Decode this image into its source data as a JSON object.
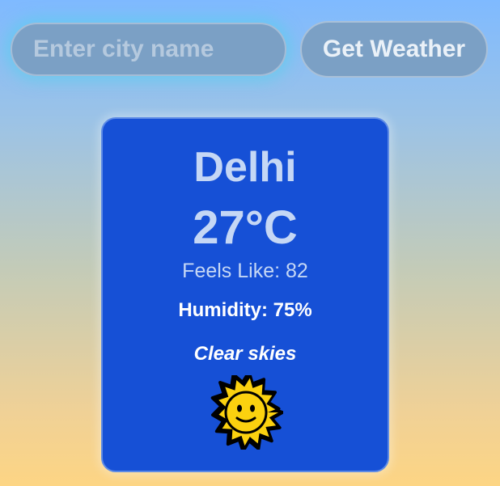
{
  "search": {
    "placeholder": "Enter city name",
    "button_label": "Get Weather"
  },
  "weather": {
    "city": "Delhi",
    "temperature": "27°C",
    "feels_like": "Feels Like: 82",
    "humidity": "Humidity: 75%",
    "description": "Clear skies",
    "icon": "sun-with-face-icon"
  },
  "colors": {
    "card_background": "#1650d6",
    "control_background": "#7ba0c5",
    "input_glow": "#50d2eb",
    "sun_yellow": "#fbd10f"
  }
}
